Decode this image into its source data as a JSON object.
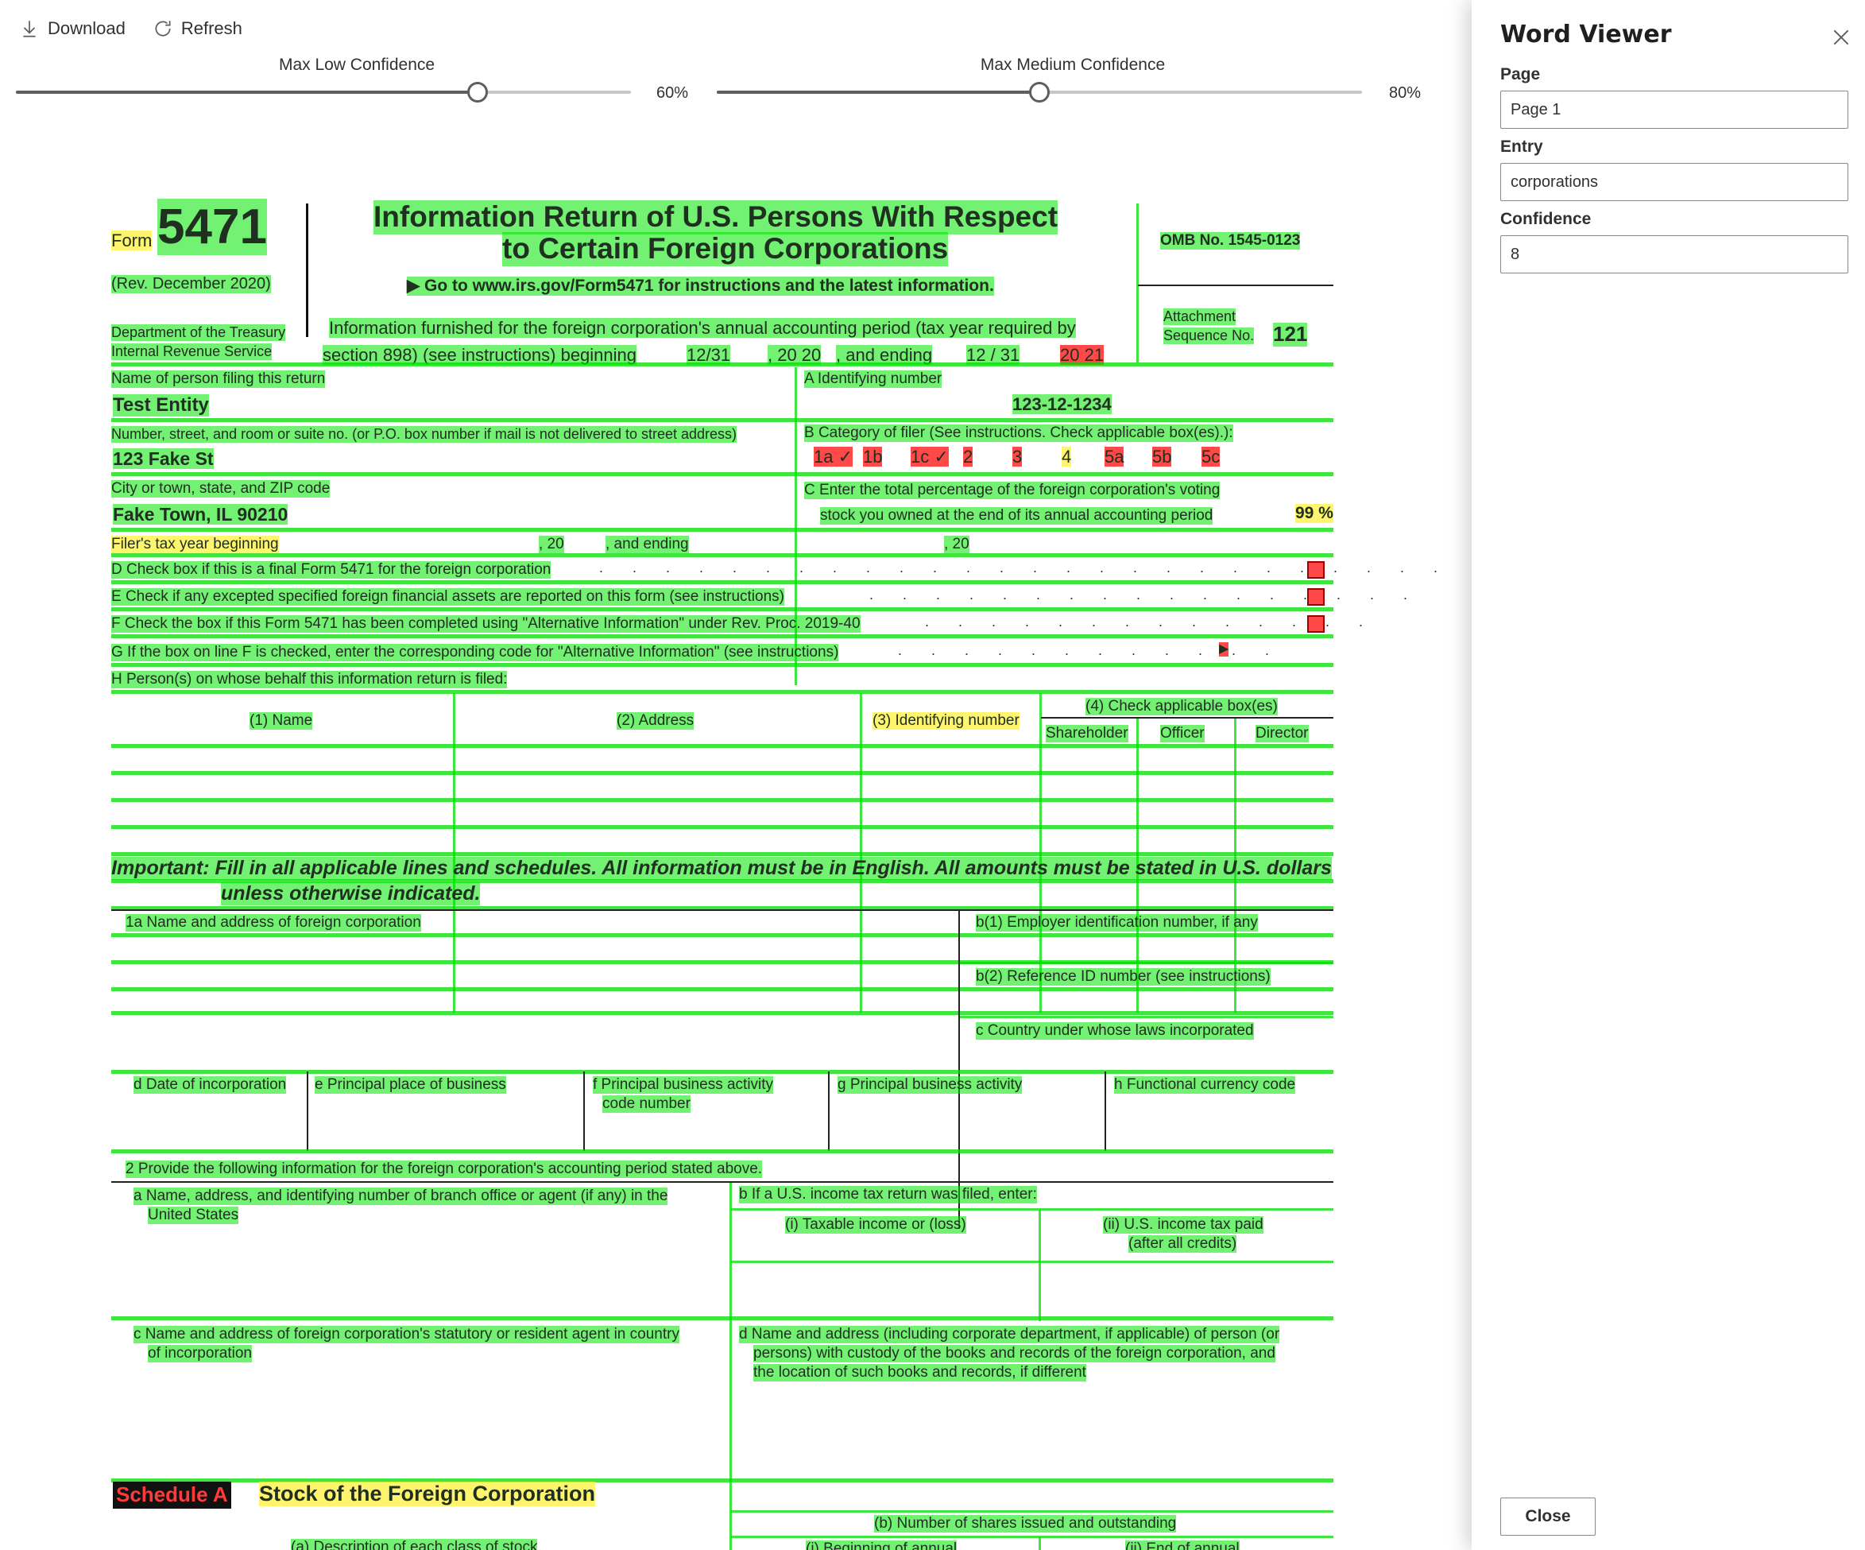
{
  "toolbar": {
    "download_label": "Download",
    "refresh_label": "Refresh"
  },
  "sliders": {
    "low": {
      "label": "Max Low Confidence",
      "value_text": "60%",
      "value": 0.75
    },
    "medium": {
      "label": "Max Medium Confidence",
      "value_text": "80%",
      "value": 0.5
    }
  },
  "colors": {
    "high_confidence": "#00e600",
    "medium_confidence": "#fff03c",
    "low_confidence": "#ff2828"
  },
  "panel": {
    "title": "Word Viewer",
    "page_label": "Page",
    "page_value": "Page 1",
    "entry_label": "Entry",
    "entry_value": "corporations",
    "confidence_label": "Confidence",
    "confidence_value": "8",
    "close_label": "Close"
  },
  "form": {
    "form_word": "Form",
    "form_number": "5471",
    "rev": "(Rev. December 2020)",
    "title_line1": "Information Return of U.S. Persons With Respect",
    "title_line2": "to Certain Foreign Corporations",
    "goto": "▶ Go to www.irs.gov/Form5471 for instructions and the latest information.",
    "omb": "OMB No. 1545-0123",
    "attachment": "Attachment",
    "sequence": "Sequence No.",
    "sequence_no": "121",
    "dept1": "Department of the Treasury",
    "dept2": "Internal Revenue Service",
    "info_line1": "Information furnished for the foreign corporation's annual accounting period (tax year required by",
    "info_line2a": "section 898) (see instructions) beginning",
    "info_begin": "12/31",
    "info_line2b": ", 20 20",
    "info_line2c": ", and ending",
    "info_end": "12 / 31",
    "info_year": "20 21",
    "name_label": "Name of person filing this return",
    "name_value": "Test Entity",
    "a_label": "A Identifying number",
    "a_value": "123-12-1234",
    "street_label": "Number, street, and room or suite no. (or P.O. box number if mail is not delivered to street address)",
    "street_value": "123 Fake St",
    "b_label": "B Category of filer (See instructions. Check applicable box(es).):",
    "b_boxes": [
      "1a ✓",
      "1b",
      "1c ✓",
      "2",
      "3",
      "4",
      "5a",
      "5b",
      "5c"
    ],
    "city_label": "City or town, state, and ZIP code",
    "city_value": "Fake Town, IL 90210",
    "c_label1": "C Enter the total percentage of the foreign corporation's voting",
    "c_label2": "stock you owned at the end of its annual accounting period",
    "c_value": "99 %",
    "filer_year": "Filer's tax year beginning",
    "filer_20a": ", 20",
    "filer_ending": ", and ending",
    "filer_20b": ", 20",
    "line_d": "D Check box if this is a final Form 5471 for the foreign corporation",
    "line_e": "E Check if any excepted specified foreign financial assets are reported on this form (see instructions)",
    "line_f": "F Check the box if this Form 5471 has been completed using \"Alternative Information\" under Rev. Proc. 2019-40",
    "line_g": "G If the box on line F is checked, enter the corresponding code for \"Alternative Information\" (see instructions)",
    "line_h": "H Person(s) on whose behalf this information return is filed:",
    "col_name": "(1) Name",
    "col_address": "(2) Address",
    "col_id": "(3) Identifying number",
    "col_check": "(4) Check applicable box(es)",
    "col_shareholder": "Shareholder",
    "col_officer": "Officer",
    "col_director": "Director",
    "important1": "Important: Fill in all applicable lines and schedules. All information must be in English. All amounts must be stated in U.S. dollars",
    "important2": "unless otherwise indicated.",
    "l1a": "1a Name and address of foreign corporation",
    "l1b1": "b(1) Employer identification number, if any",
    "l1b2": "b(2) Reference ID number (see instructions)",
    "l1c": "c Country under whose laws incorporated",
    "l1d": "d Date of incorporation",
    "l1e": "e Principal place of business",
    "l1f1": "f Principal business activity",
    "l1f2": "code number",
    "l1g": "g Principal business activity",
    "l1h": "h Functional currency code",
    "l2": "2 Provide the following information for the foreign corporation's accounting period stated above.",
    "l2a1": "a Name, address, and identifying number of branch office or agent (if any) in the",
    "l2a2": "United States",
    "l2b": "b If a U.S. income tax return was filed, enter:",
    "l2bi": "(i) Taxable income or (loss)",
    "l2bii1": "(ii) U.S. income tax paid",
    "l2bii2": "(after all credits)",
    "l2c1": "c Name and address of foreign corporation's statutory or resident agent in country",
    "l2c2": "of incorporation",
    "l2d1": "d Name and address (including corporate department, if applicable) of person (or",
    "l2d2": "persons) with custody of the books and records of the foreign corporation, and",
    "l2d3": "the location of such books and records, if different",
    "sched_a": "Schedule A",
    "sched_a_title": "Stock of the Foreign Corporation",
    "sched_b": "(b) Number of shares issued and outstanding",
    "sched_a_col": "(a) Description of each class of stock",
    "sched_bi": "(i) Beginning of annual",
    "sched_bii": "(ii) End of annual"
  }
}
